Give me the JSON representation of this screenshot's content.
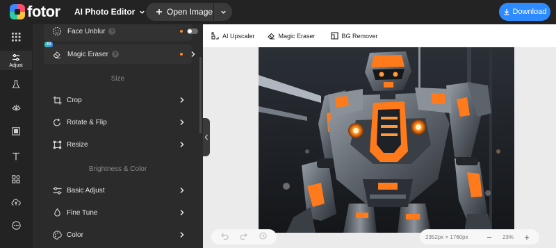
{
  "app": {
    "logo_text": "fotor",
    "editor_menu": "AI Photo Editor"
  },
  "header": {
    "open_label": "Open Image",
    "download_label": "Download"
  },
  "rail": {
    "items": [
      {
        "icon": "grid-icon"
      },
      {
        "icon": "sliders-icon",
        "label": "Adjust",
        "active": true
      },
      {
        "icon": "flask-icon"
      },
      {
        "icon": "eye-icon"
      },
      {
        "icon": "frame-icon"
      },
      {
        "icon": "text-icon"
      },
      {
        "icon": "elements-icon"
      },
      {
        "icon": "cloud-upload-icon"
      },
      {
        "icon": "more-icon"
      }
    ]
  },
  "panel": {
    "cards": [
      {
        "badge": "AI",
        "label": "Face Unblur",
        "help": "?",
        "control": "toggle",
        "enabled": false
      },
      {
        "badge": "AI",
        "label": "Magic Eraser",
        "help": "?",
        "control": "chevron"
      }
    ],
    "sections": [
      {
        "title": "Size",
        "rows": [
          {
            "label": "Crop"
          },
          {
            "label": "Rotate & Flip"
          },
          {
            "label": "Resize"
          }
        ]
      },
      {
        "title": "Brightness & Color",
        "rows": [
          {
            "label": "Basic Adjust"
          },
          {
            "label": "Fine Tune"
          },
          {
            "label": "Color"
          }
        ]
      }
    ]
  },
  "toolstrip": {
    "tools": [
      {
        "label": "AI Upscaler"
      },
      {
        "label": "Magic Eraser"
      },
      {
        "label": "BG Remover"
      }
    ]
  },
  "canvas": {
    "dimensions": "2352px × 1760px",
    "zoom": "23%",
    "zoom_out": "−",
    "zoom_in": "+"
  },
  "colors": {
    "accent": "#2e8bff",
    "panel_bg": "#2b2b2b",
    "notify": "#ff4b4b",
    "dot": "#ff8a2b"
  }
}
